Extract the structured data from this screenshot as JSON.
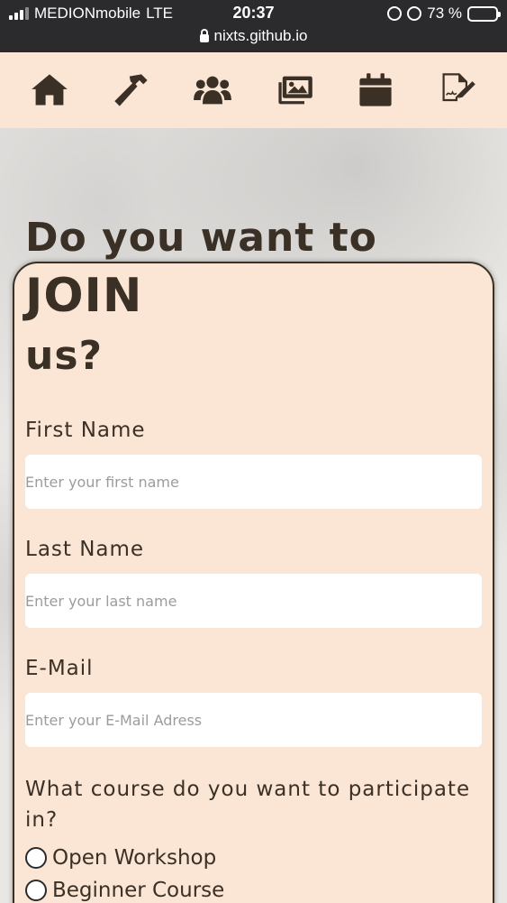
{
  "status_bar": {
    "carrier": "MEDIONmobile",
    "network": "LTE",
    "time": "20:37",
    "battery": "73 %",
    "url": "nixts.github.io"
  },
  "nav": {
    "items": [
      {
        "icon": "home-icon"
      },
      {
        "icon": "hammer-icon"
      },
      {
        "icon": "users-icon"
      },
      {
        "icon": "images-icon"
      },
      {
        "icon": "calendar-icon"
      },
      {
        "icon": "signature-icon"
      }
    ]
  },
  "form": {
    "title_prefix": "Do you want to ",
    "title_emph": "JOIN",
    "title_suffix": "us?",
    "first_name": {
      "label": "First Name",
      "placeholder": "Enter your first name",
      "value": ""
    },
    "last_name": {
      "label": "Last Name",
      "placeholder": "Enter your last name",
      "value": ""
    },
    "email": {
      "label": "E-Mail",
      "placeholder": "Enter your E-Mail Adress",
      "value": ""
    },
    "course_question": "What course do you want to participate in?",
    "course_options": [
      "Open Workshop",
      "Beginner Course"
    ]
  }
}
